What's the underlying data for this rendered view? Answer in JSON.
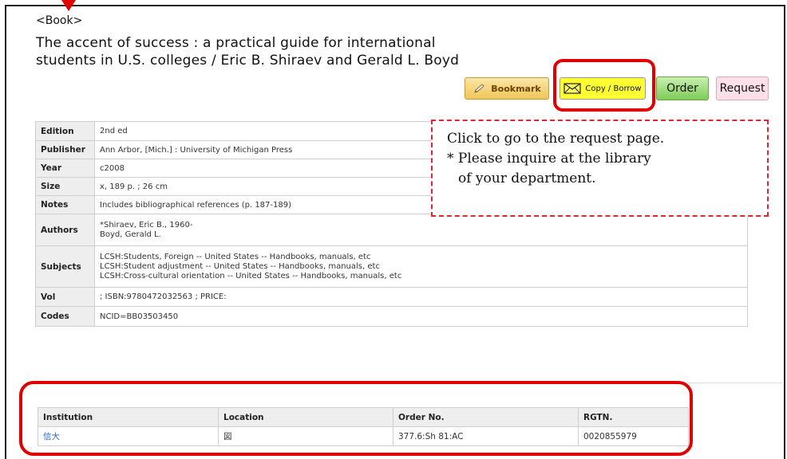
{
  "record": {
    "type_label": "<Book>",
    "title_line1": "The accent of success : a practical guide for international",
    "title_line2": "students in U.S. colleges / Eric B. Shiraev and Gerald L. Boyd"
  },
  "actions": {
    "bookmark_label": "Bookmark",
    "copy_borrow_label": "Copy / Borrow",
    "order_label": "Order",
    "request_label": "Request"
  },
  "callout": {
    "line1": "Click to go to the request page.",
    "line2": "* Please inquire at the library",
    "line3": "of your department."
  },
  "details": {
    "edition": {
      "label": "Edition",
      "value": "2nd ed"
    },
    "publisher": {
      "label": "Publisher",
      "value": "Ann Arbor, [Mich.] : University of Michigan Press"
    },
    "year": {
      "label": "Year",
      "value": "c2008"
    },
    "size": {
      "label": "Size",
      "value": "x, 189 p. ; 26 cm"
    },
    "notes": {
      "label": "Notes",
      "value": "Includes bibliographical references (p. 187-189)"
    },
    "authors": {
      "label": "Authors",
      "values": [
        "*Shiraev, Eric B., 1960-",
        "Boyd, Gerald L."
      ]
    },
    "subjects": {
      "label": "Subjects",
      "values": [
        "LCSH:Students, Foreign -- United States -- Handbooks, manuals, etc",
        "LCSH:Student adjustment -- United States -- Handbooks, manuals, etc",
        "LCSH:Cross-cultural orientation -- United States -- Handbooks, manuals, etc"
      ]
    },
    "vol": {
      "label": "Vol",
      "value": "; ISBN:9780472032563 ; PRICE:"
    },
    "codes": {
      "label": "Codes",
      "value": "NCID=BB03503450"
    }
  },
  "holdings": {
    "columns": [
      "Institution",
      "Location",
      "Order No.",
      "RGTN."
    ],
    "rows": [
      {
        "institution": "信大",
        "location": "図",
        "order_no": "377.6:Sh 81:AC",
        "rgtn": "0020855979"
      }
    ]
  },
  "colors": {
    "highlight": "#e00000",
    "link": "#2a64c8",
    "copy_button": "#ffff33",
    "order_button": "#7ecb57",
    "request_button": "#ffe0ea"
  }
}
